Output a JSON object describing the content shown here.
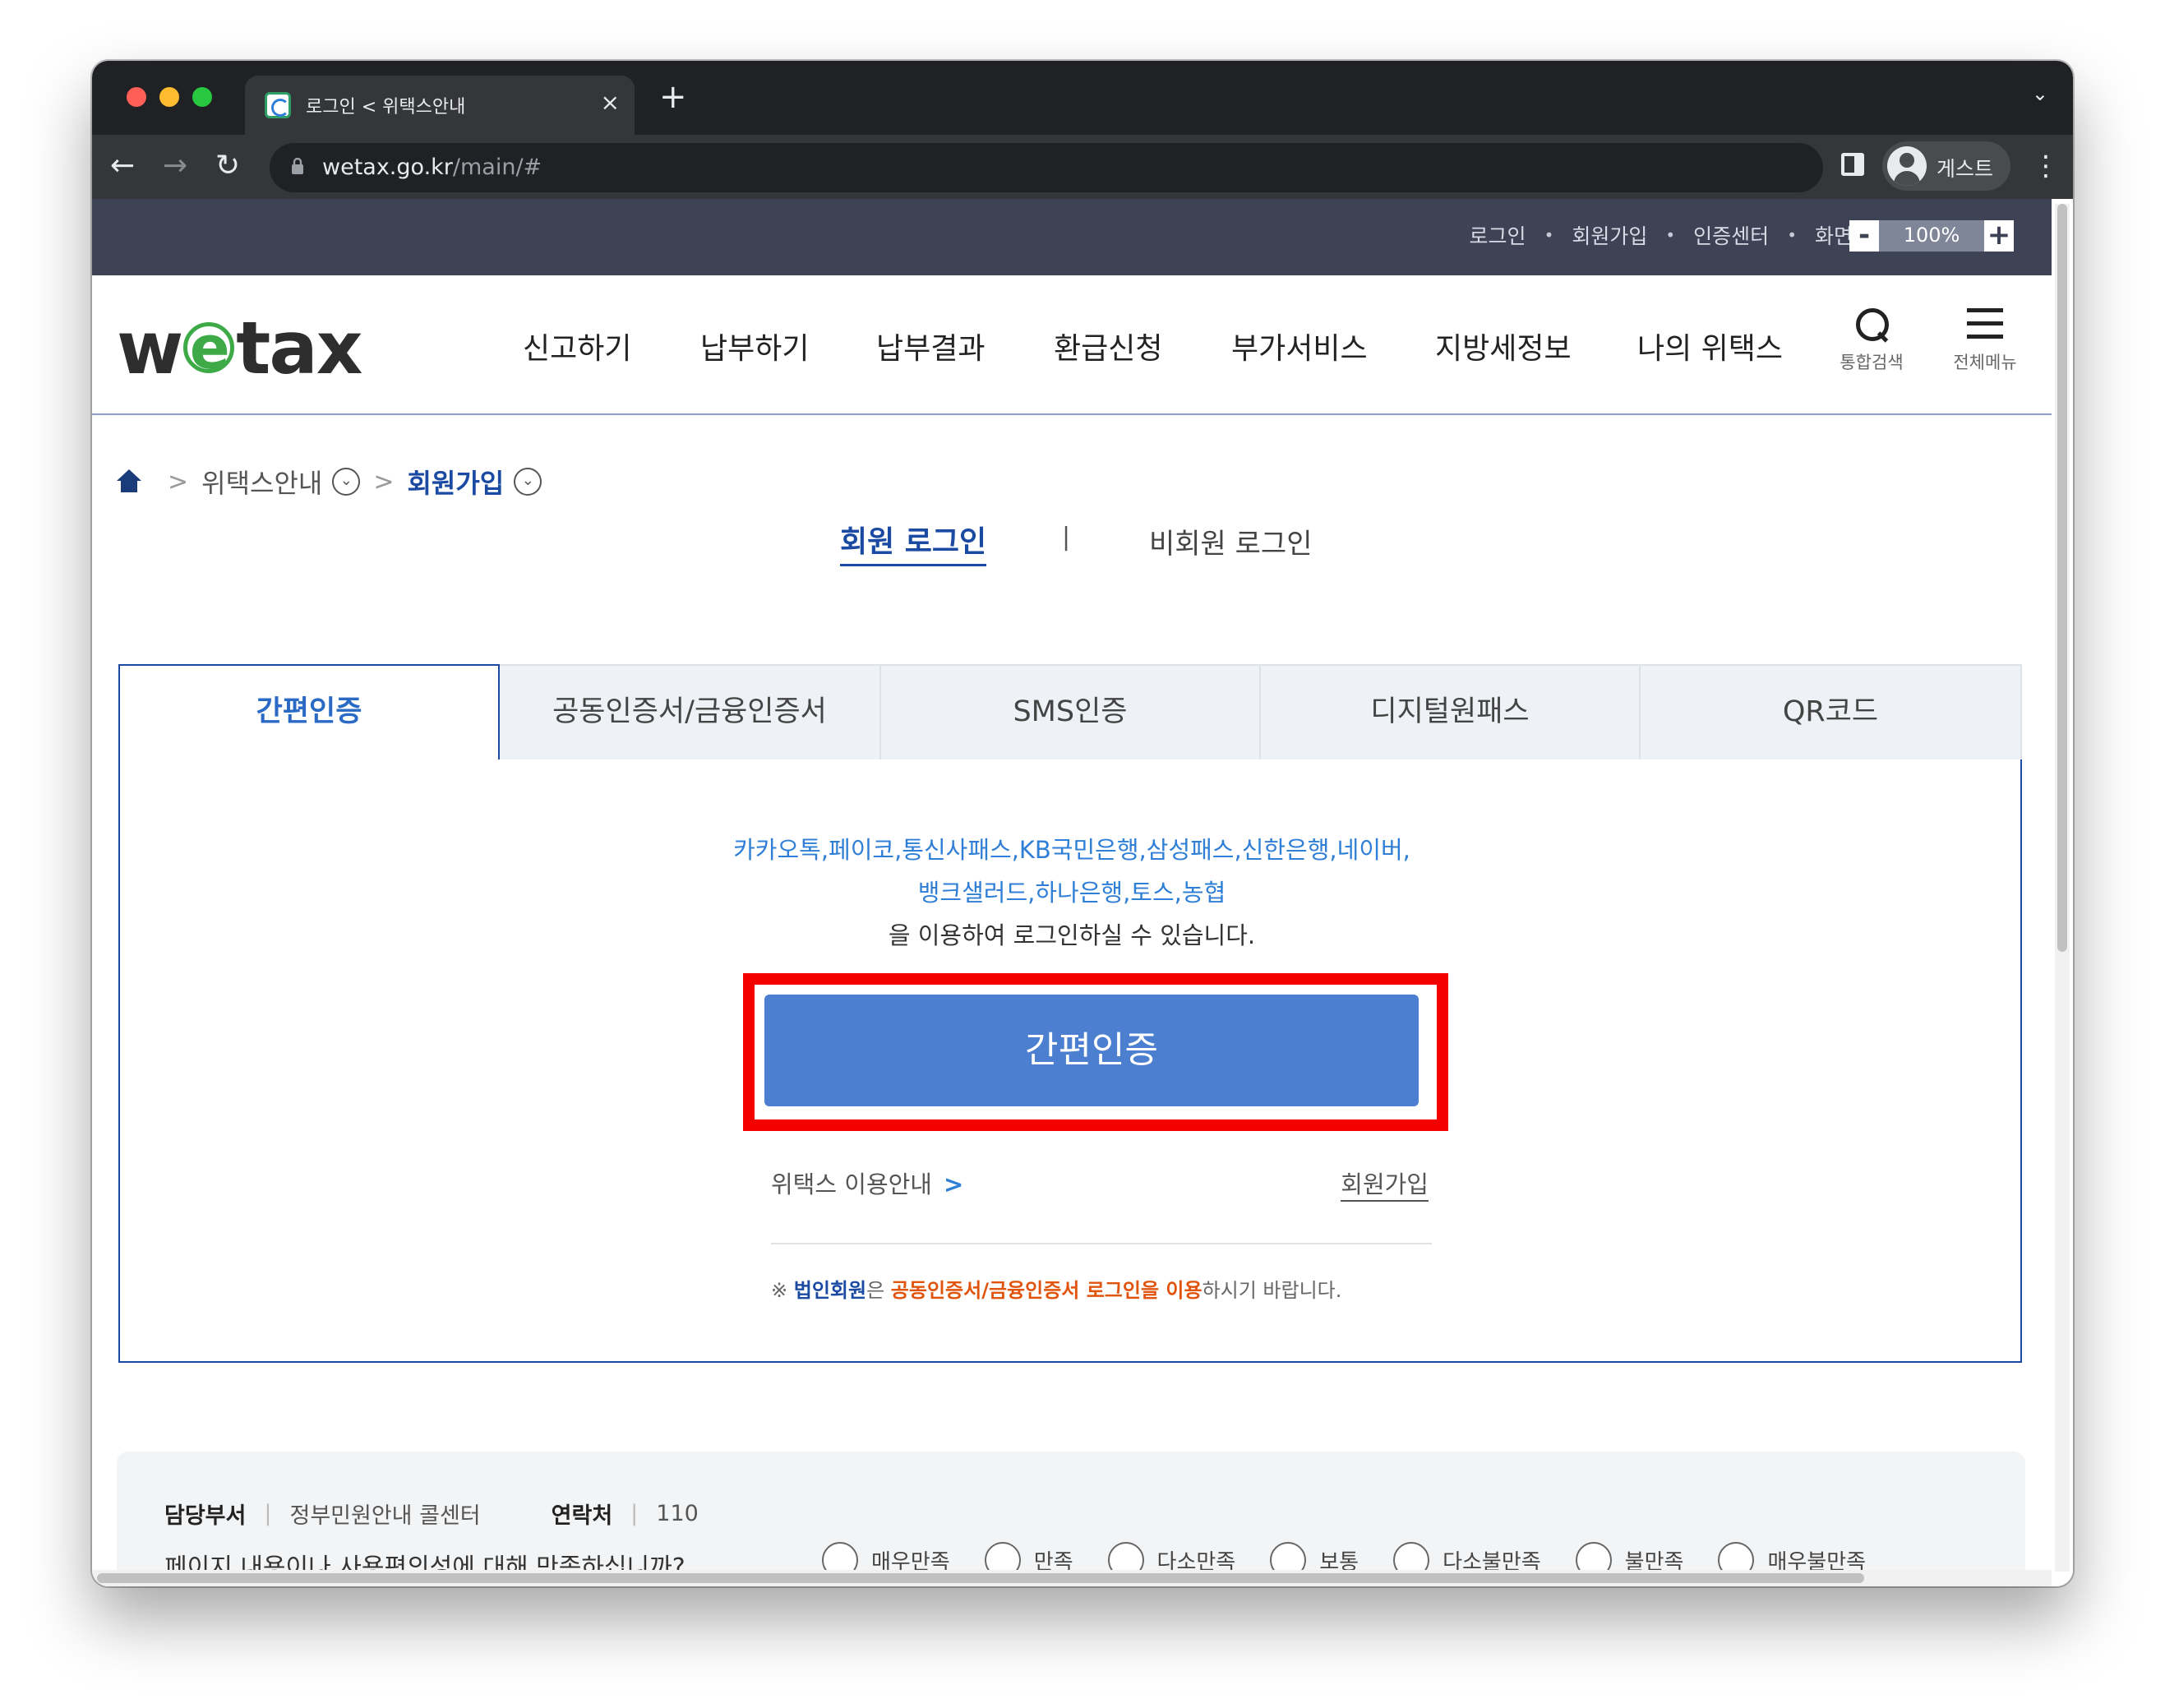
{
  "browser": {
    "tab_title": "로그인 < 위택스안내",
    "tab_close": "×",
    "new_tab": "+",
    "tab_dropdown": "⌄",
    "nav_back": "←",
    "nav_forward": "→",
    "nav_reload": "↻",
    "url_host": "wetax.go.kr",
    "url_path": "/main/#",
    "profile_label": "게스트",
    "menu": "⋮"
  },
  "utilbar": {
    "links": [
      "로그인",
      "회원가입",
      "인증센터",
      "화면크기"
    ],
    "separator": "•",
    "zoom_minus": "-",
    "zoom_value": "100%",
    "zoom_plus": "+"
  },
  "header": {
    "logo_w": "w",
    "logo_e": "e",
    "logo_tax": "tax",
    "nav": [
      "신고하기",
      "납부하기",
      "납부결과",
      "환급신청",
      "부가서비스",
      "지방세정보",
      "나의 위택스"
    ],
    "search_label": "통합검색",
    "menu_label": "전체메뉴"
  },
  "breadcrumb": {
    "sep": ">",
    "level1": "위택스안내",
    "level2": "회원가입",
    "toggle": "⌄"
  },
  "login_tabs": {
    "member": "회원 로그인",
    "bar": "|",
    "guest": "비회원 로그인"
  },
  "auth_tabs": [
    "간편인증",
    "공동인증서/금융인증서",
    "SMS인증",
    "디지털원패스",
    "QR코드"
  ],
  "auth_panel": {
    "providers_line1": "카카오톡,페이코,통신사패스,KB국민은행,삼성패스,신한은행,네이버,",
    "providers_line2": "뱅크샐러드,하나은행,토스,농협",
    "desc_line3": "을 이용하여 로그인하실 수 있습니다.",
    "button": "간편인증",
    "guide_link": "위택스 이용안내",
    "guide_arrow": ">",
    "join_link": "회원가입",
    "notice_prefix": "※ ",
    "notice_corp": "법인회원",
    "notice_mid": "은 ",
    "notice_cert": "공동인증서/금융인증서 로그인을 이용",
    "notice_suffix": "하시기 바랍니다."
  },
  "footer_panel": {
    "dept_label": "담당부서",
    "dept_value": "정부민원안내 콜센터",
    "contact_label": "연락처",
    "contact_value": "110",
    "vsep": "|",
    "question": "페이지 내용이나 사용편의성에 대해 만족하십니까?",
    "ratings": [
      "매우만족",
      "만족",
      "다소만족",
      "보통",
      "다소불만족",
      "불만족",
      "매우불만족"
    ]
  },
  "colors": {
    "brand_blue": "#1b4aa3",
    "button_blue": "#4c7fd0",
    "highlight_red": "#f40000",
    "logo_green": "#3daa47"
  }
}
